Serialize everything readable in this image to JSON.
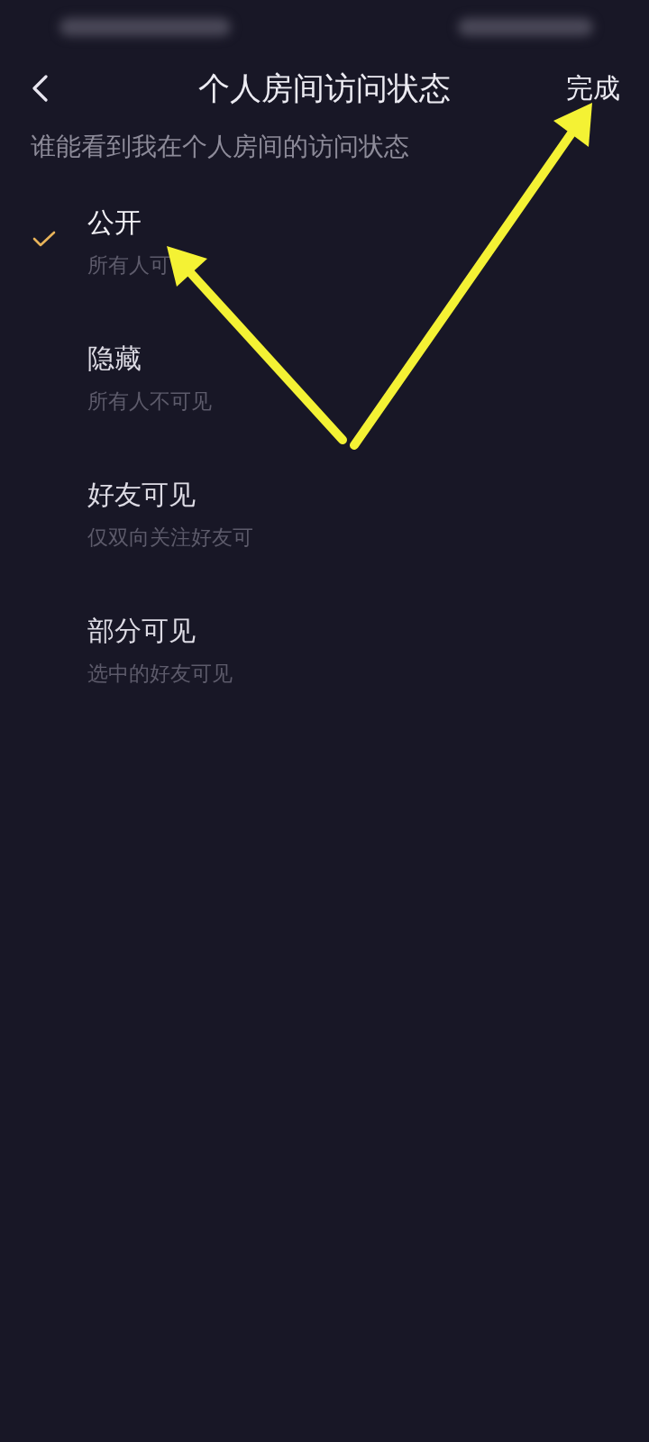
{
  "header": {
    "title": "个人房间访问状态",
    "done": "完成"
  },
  "prompt": "谁能看到我在个人房间的访问状态",
  "options": [
    {
      "title": "公开",
      "description": "所有人可",
      "selected": true
    },
    {
      "title": "隐藏",
      "description": "所有人不可见",
      "selected": false
    },
    {
      "title": "好友可见",
      "description": "仅双向关注好友可",
      "selected": false
    },
    {
      "title": "部分可见",
      "description": "选中的好友可见",
      "selected": false
    }
  ]
}
